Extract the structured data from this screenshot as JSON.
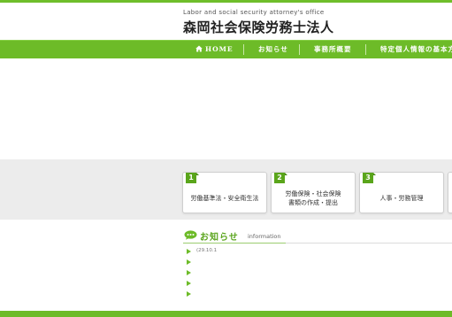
{
  "header": {
    "tagline": "Labor and social security attorney's office",
    "title": "森岡社会保険労務士法人"
  },
  "nav": {
    "items": [
      {
        "label": "HOME",
        "icon": "home-icon"
      },
      {
        "label": "お知らせ"
      },
      {
        "label": "事務所概要"
      },
      {
        "label": "特定個人情報の基本方"
      }
    ]
  },
  "services": [
    {
      "number": "1",
      "lines": [
        "労働基準法・安全衛生法"
      ]
    },
    {
      "number": "2",
      "lines": [
        "労働保険・社会保険",
        "書類の作成・提出"
      ]
    },
    {
      "number": "3",
      "lines": [
        "人事・労務管理"
      ]
    }
  ],
  "news": {
    "title": "お知らせ",
    "subtitle": "information",
    "items": [
      {
        "date": "(29.10.1"
      },
      {
        "date": ""
      },
      {
        "date": ""
      },
      {
        "date": ""
      },
      {
        "date": ""
      }
    ]
  },
  "colors": {
    "accent": "#6dbb28",
    "band": "#ececec"
  }
}
